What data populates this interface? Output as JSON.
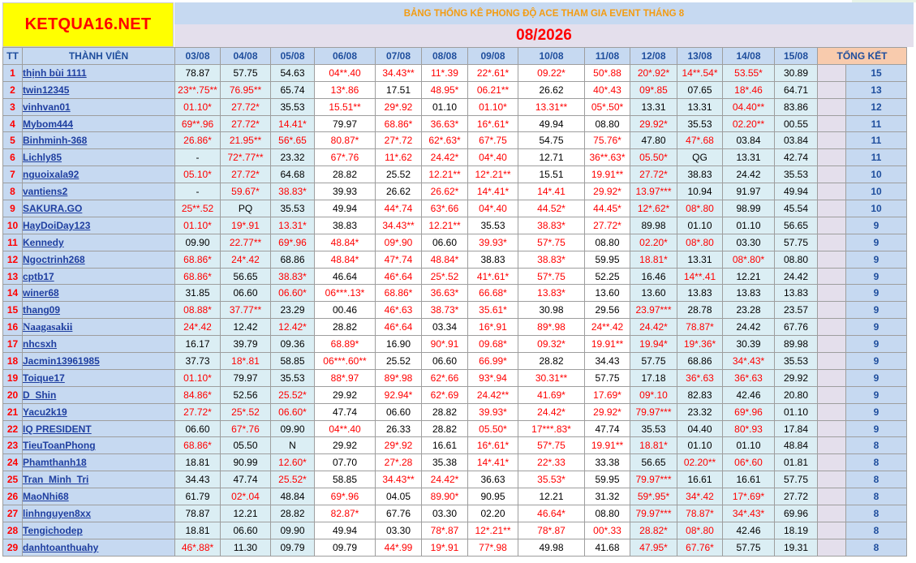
{
  "logo_text": "KETQUA16.NET",
  "title": "BẢNG THỐNG KÊ PHONG ĐỘ ACE THAM GIA EVENT THÁNG 8",
  "month": "08/2026",
  "headers": {
    "tt": "TT",
    "member": "THÀNH VIÊN",
    "dates": [
      "03/08",
      "04/08",
      "05/08",
      "06/08",
      "07/08",
      "08/08",
      "09/08",
      "10/08",
      "11/08",
      "12/08",
      "13/08",
      "14/08",
      "15/08"
    ],
    "total": "TỔNG KẾT"
  },
  "colors": {
    "red_text": "#ff0000",
    "name_text": "#1f3fa0",
    "header_bg": "#c6d9f1",
    "logo_bg": "#ffff00"
  },
  "rows": [
    {
      "tt": "1",
      "name": "thịnh bùi 1111",
      "cells": [
        "78.87",
        "57.75",
        "54.63",
        "04**.40",
        "34.43**",
        "11*.39",
        "22*.61*",
        "09.22*",
        "50*.88",
        "20*.92*",
        "14**.54*",
        "53.55*",
        "30.89"
      ],
      "total": "15"
    },
    {
      "tt": "2",
      "name": "twin12345",
      "cells": [
        "23**.75**",
        "76.95**",
        "65.74",
        "13*.86",
        "17.51",
        "48.95*",
        "06.21**",
        "26.62",
        "40*.43",
        "09*.85",
        "07.65",
        "18*.46",
        "64.71"
      ],
      "total": "13"
    },
    {
      "tt": "3",
      "name": "vinhvan01",
      "cells": [
        "01.10*",
        "27.72*",
        "35.53",
        "15.51**",
        "29*.92",
        "01.10",
        "01.10*",
        "13.31**",
        "05*.50*",
        "13.31",
        "13.31",
        "04.40**",
        "83.86"
      ],
      "total": "12"
    },
    {
      "tt": "4",
      "name": "Mybom444",
      "cells": [
        "69**.96",
        "27.72*",
        "14.41*",
        "79.97",
        "68.86*",
        "36.63*",
        "16*.61*",
        "49.94",
        "08.80",
        "29.92*",
        "35.53",
        "02.20**",
        "00.55"
      ],
      "total": "11"
    },
    {
      "tt": "5",
      "name": "Binhminh-368",
      "cells": [
        "26.86*",
        "21.95**",
        "56*.65",
        "80.87*",
        "27*.72",
        "62*.63*",
        "67*.75",
        "54.75",
        "75.76*",
        "47.80",
        "47*.68",
        "03.84",
        "03.84"
      ],
      "total": "11"
    },
    {
      "tt": "6",
      "name": "Lichly85",
      "cells": [
        "-",
        "72*.77**",
        "23.32",
        "67*.76",
        "11*.62",
        "24.42*",
        "04*.40",
        "12.71",
        "36**.63*",
        "05.50*",
        "QG",
        "13.31",
        "42.74"
      ],
      "total": "11"
    },
    {
      "tt": "7",
      "name": "nguoixala92",
      "cells": [
        "05.10*",
        "27.72*",
        "64.68",
        "28.82",
        "25.52",
        "12.21**",
        "12*.21**",
        "15.51",
        "19.91**",
        "27.72*",
        "38.83",
        "24.42",
        "35.53"
      ],
      "total": "10"
    },
    {
      "tt": "8",
      "name": "vantiens2",
      "cells": [
        "-",
        "59.67*",
        "38.83*",
        "39.93",
        "26.62",
        "26.62*",
        "14*.41*",
        "14*.41",
        "29.92*",
        "13.97***",
        "10.94",
        "91.97",
        "49.94"
      ],
      "total": "10"
    },
    {
      "tt": "9",
      "name": "SAKURA.GO",
      "cells": [
        "25**.52",
        "PQ",
        "35.53",
        "49.94",
        "44*.74",
        "63*.66",
        "04*.40",
        "44.52*",
        "44.45*",
        "12*.62*",
        "08*.80",
        "98.99",
        "45.54"
      ],
      "total": "10"
    },
    {
      "tt": "10",
      "name": "HayDoiDay123",
      "cells": [
        "01.10*",
        "19*.91",
        "13.31*",
        "38.83",
        "34.43**",
        "12.21**",
        "35.53",
        "38.83*",
        "27.72*",
        "89.98",
        "01.10",
        "01.10",
        "56.65"
      ],
      "total": "9"
    },
    {
      "tt": "11",
      "name": "Kennedy",
      "cells": [
        "09.90",
        "22.77**",
        "69*.96",
        "48.84*",
        "09*.90",
        "06.60",
        "39.93*",
        "57*.75",
        "08.80",
        "02.20*",
        "08*.80",
        "03.30",
        "57.75"
      ],
      "total": "9"
    },
    {
      "tt": "12",
      "name": "Ngoctrinh268",
      "cells": [
        "68.86*",
        "24*.42",
        "68.86",
        "48.84*",
        "47*.74",
        "48.84*",
        "38.83",
        "38.83*",
        "59.95",
        "18.81*",
        "13.31",
        "08*.80*",
        "08.80"
      ],
      "total": "9"
    },
    {
      "tt": "13",
      "name": "cptb17",
      "cells": [
        "68.86*",
        "56.65",
        "38.83*",
        "46.64",
        "46*.64",
        "25*.52",
        "41*.61*",
        "57*.75",
        "52.25",
        "16.46",
        "14**.41",
        "12.21",
        "24.42"
      ],
      "total": "9"
    },
    {
      "tt": "14",
      "name": "winer68",
      "cells": [
        "31.85",
        "06.60",
        "06.60*",
        "06***.13*",
        "68.86*",
        "36.63*",
        "66.68*",
        "13.83*",
        "13.60",
        "13.60",
        "13.83",
        "13.83",
        "13.83"
      ],
      "total": "9"
    },
    {
      "tt": "15",
      "name": "thang09",
      "cells": [
        "08.88*",
        "37.77**",
        "23.29",
        "00.46",
        "46*.63",
        "38.73*",
        "35.61*",
        "30.98",
        "29.56",
        "23.97***",
        "28.78",
        "23.28",
        "23.57"
      ],
      "total": "9"
    },
    {
      "tt": "16",
      "name": "Naagasakii",
      "cells": [
        "24*.42",
        "12.42",
        "12.42*",
        "28.82",
        "46*.64",
        "03.34",
        "16*.91",
        "89*.98",
        "24**.42",
        "24.42*",
        "78.87*",
        "24.42",
        "67.76"
      ],
      "total": "9"
    },
    {
      "tt": "17",
      "name": "nhcsxh",
      "cells": [
        "16.17",
        "39.79",
        "09.36",
        "68.89*",
        "16.90",
        "90*.91",
        "09.68*",
        "09.32*",
        "19.91**",
        "19.94*",
        "19*.36*",
        "30.39",
        "89.98"
      ],
      "total": "9"
    },
    {
      "tt": "18",
      "name": "Jacmin13961985",
      "cells": [
        "37.73",
        "18*.81",
        "58.85",
        "06***.60**",
        "25.52",
        "06.60",
        "66.99*",
        "28.82",
        "34.43",
        "57.75",
        "68.86",
        "34*.43*",
        "35.53"
      ],
      "total": "9"
    },
    {
      "tt": "19",
      "name": "Toique17",
      "cells": [
        "01.10*",
        "79.97",
        "35.53",
        "88*.97",
        "89*.98",
        "62*.66",
        "93*.94",
        "30.31**",
        "57.75",
        "17.18",
        "36*.63",
        "36*.63",
        "29.92"
      ],
      "total": "9"
    },
    {
      "tt": "20",
      "name": "D_Shin",
      "cells": [
        "84.86*",
        "52.56",
        "25.52*",
        "29.92",
        "92.94*",
        "62*.69",
        "24.42**",
        "41.69*",
        "17.69*",
        "09*.10",
        "82.83",
        "42.46",
        "20.80"
      ],
      "total": "9"
    },
    {
      "tt": "21",
      "name": "Yacu2k19",
      "cells": [
        "27.72*",
        "25*.52",
        "06.60*",
        "47.74",
        "06.60",
        "28.82",
        "39.93*",
        "24.42*",
        "29.92*",
        "79.97***",
        "23.32",
        "69*.96",
        "01.10"
      ],
      "total": "9"
    },
    {
      "tt": "22",
      "name": "IQ PRESIDENT",
      "cells": [
        "06.60",
        "67*.76",
        "09.90",
        "04**.40",
        "26.33",
        "28.82",
        "05.50*",
        "17***.83*",
        "47.74",
        "35.53",
        "04.40",
        "80*.93",
        "17.84"
      ],
      "total": "9"
    },
    {
      "tt": "23",
      "name": "TieuToanPhong",
      "cells": [
        "68.86*",
        "05.50",
        "N",
        "29.92",
        "29*.92",
        "16.61",
        "16*.61*",
        "57*.75",
        "19.91**",
        "18.81*",
        "01.10",
        "01.10",
        "48.84"
      ],
      "total": "8"
    },
    {
      "tt": "24",
      "name": "Phamthanh18",
      "cells": [
        "18.81",
        "90.99",
        "12.60*",
        "07.70",
        "27*.28",
        "35.38",
        "14*.41*",
        "22*.33",
        "33.38",
        "56.65",
        "02.20**",
        "06*.60",
        "01.81"
      ],
      "total": "8"
    },
    {
      "tt": "25",
      "name": "Tran_Minh_Tri",
      "cells": [
        "34.43",
        "47.74",
        "25.52*",
        "58.85",
        "34.43**",
        "24.42*",
        "36.63",
        "35.53*",
        "59.95",
        "79.97***",
        "16.61",
        "16.61",
        "57.75"
      ],
      "total": "8"
    },
    {
      "tt": "26",
      "name": "MaoNhi68",
      "cells": [
        "61.79",
        "02*.04",
        "48.84",
        "69*.96",
        "04.05",
        "89.90*",
        "90.95",
        "12.21",
        "31.32",
        "59*.95*",
        "34*.42",
        "17*.69*",
        "27.72"
      ],
      "total": "8"
    },
    {
      "tt": "27",
      "name": "linhnguyen8xx",
      "cells": [
        "78.87",
        "12.21",
        "28.82",
        "82.87*",
        "67.76",
        "03.30",
        "02.20",
        "46.64*",
        "08.80",
        "79.97***",
        "78.87*",
        "34*.43*",
        "69.96"
      ],
      "total": "8"
    },
    {
      "tt": "28",
      "name": "Tengichodep",
      "cells": [
        "18.81",
        "06.60",
        "09.90",
        "49.94",
        "03.30",
        "78*.87",
        "12*.21**",
        "78*.87",
        "00*.33",
        "28.82*",
        "08*.80",
        "42.46",
        "18.19"
      ],
      "total": "8"
    },
    {
      "tt": "29",
      "name": "danhtoanthuahy",
      "cells": [
        "46*.88*",
        "11.30",
        "09.79",
        "09.79",
        "44*.99",
        "19*.91",
        "77*.98",
        "49.98",
        "41.68",
        "47.95*",
        "67.76*",
        "57.75",
        "19.31"
      ],
      "total": "8"
    }
  ]
}
